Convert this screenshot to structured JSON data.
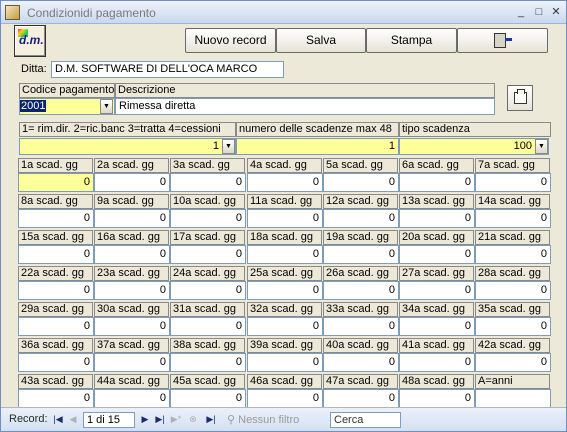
{
  "window": {
    "title": "Condizionidi pagamento",
    "min_label": "_",
    "max_label": "□",
    "close_label": "✕"
  },
  "toolbar": {
    "logo_text": "d.m.",
    "new_label": "Nuovo record",
    "save_label": "Salva",
    "print_label": "Stampa"
  },
  "ditta": {
    "label": "Ditta:",
    "value": "D.M. SOFTWARE DI DELL'OCA MARCO"
  },
  "codice": {
    "label": "Codice pagamento",
    "value": "2001"
  },
  "descrizione": {
    "label": "Descrizione",
    "value": "Rimessa diretta"
  },
  "tipo_rimessa": {
    "label": "1= rim.dir. 2=ric.banc 3=tratta 4=cessioni",
    "value": "1"
  },
  "numero_scadenze": {
    "label": "numero delle scadenze max 48",
    "value": "1"
  },
  "tipo_scadenza": {
    "label": "tipo scadenza",
    "value": "100"
  },
  "scadenze": [
    {
      "label": "1a scad. gg",
      "value": "0"
    },
    {
      "label": "2a scad. gg",
      "value": "0"
    },
    {
      "label": "3a scad. gg",
      "value": "0"
    },
    {
      "label": "4a scad. gg",
      "value": "0"
    },
    {
      "label": "5a scad. gg",
      "value": "0"
    },
    {
      "label": "6a scad. gg",
      "value": "0"
    },
    {
      "label": "7a scad. gg",
      "value": "0"
    },
    {
      "label": "8a scad. gg",
      "value": "0"
    },
    {
      "label": "9a scad. gg",
      "value": "0"
    },
    {
      "label": "10a scad. gg",
      "value": "0"
    },
    {
      "label": "11a scad. gg",
      "value": "0"
    },
    {
      "label": "12a scad. gg",
      "value": "0"
    },
    {
      "label": "13a scad. gg",
      "value": "0"
    },
    {
      "label": "14a scad. gg",
      "value": "0"
    },
    {
      "label": "15a scad. gg",
      "value": "0"
    },
    {
      "label": "16a scad. gg",
      "value": "0"
    },
    {
      "label": "17a scad. gg",
      "value": "0"
    },
    {
      "label": "18a scad. gg",
      "value": "0"
    },
    {
      "label": "19a scad. gg",
      "value": "0"
    },
    {
      "label": "20a scad. gg",
      "value": "0"
    },
    {
      "label": "21a scad. gg",
      "value": "0"
    },
    {
      "label": "22a scad. gg",
      "value": "0"
    },
    {
      "label": "23a scad. gg",
      "value": "0"
    },
    {
      "label": "24a scad. gg",
      "value": "0"
    },
    {
      "label": "25a scad. gg",
      "value": "0"
    },
    {
      "label": "26a scad. gg",
      "value": "0"
    },
    {
      "label": "27a scad. gg",
      "value": "0"
    },
    {
      "label": "28a scad. gg",
      "value": "0"
    },
    {
      "label": "29a scad. gg",
      "value": "0"
    },
    {
      "label": "30a scad. gg",
      "value": "0"
    },
    {
      "label": "31a scad. gg",
      "value": "0"
    },
    {
      "label": "32a scad. gg",
      "value": "0"
    },
    {
      "label": "33a scad. gg",
      "value": "0"
    },
    {
      "label": "34a scad. gg",
      "value": "0"
    },
    {
      "label": "35a scad. gg",
      "value": "0"
    },
    {
      "label": "36a scad. gg",
      "value": "0"
    },
    {
      "label": "37a scad. gg",
      "value": "0"
    },
    {
      "label": "38a scad. gg",
      "value": "0"
    },
    {
      "label": "39a scad. gg",
      "value": "0"
    },
    {
      "label": "40a scad. gg",
      "value": "0"
    },
    {
      "label": "41a scad. gg",
      "value": "0"
    },
    {
      "label": "42a scad. gg",
      "value": "0"
    },
    {
      "label": "43a scad. gg",
      "value": "0"
    },
    {
      "label": "44a scad. gg",
      "value": "0"
    },
    {
      "label": "45a scad. gg",
      "value": "0"
    },
    {
      "label": "46a scad. gg",
      "value": "0"
    },
    {
      "label": "47a scad. gg",
      "value": "0"
    },
    {
      "label": "48a scad. gg",
      "value": "0"
    },
    {
      "label": "A=anni",
      "value": ""
    }
  ],
  "statusbar": {
    "record_label": "Record:",
    "record_value": "1 di 15",
    "filter_label": "Nessun filtro",
    "search_label": "Cerca"
  },
  "colors": {
    "highlight": "#ffff99",
    "selection": "#0a246a"
  }
}
